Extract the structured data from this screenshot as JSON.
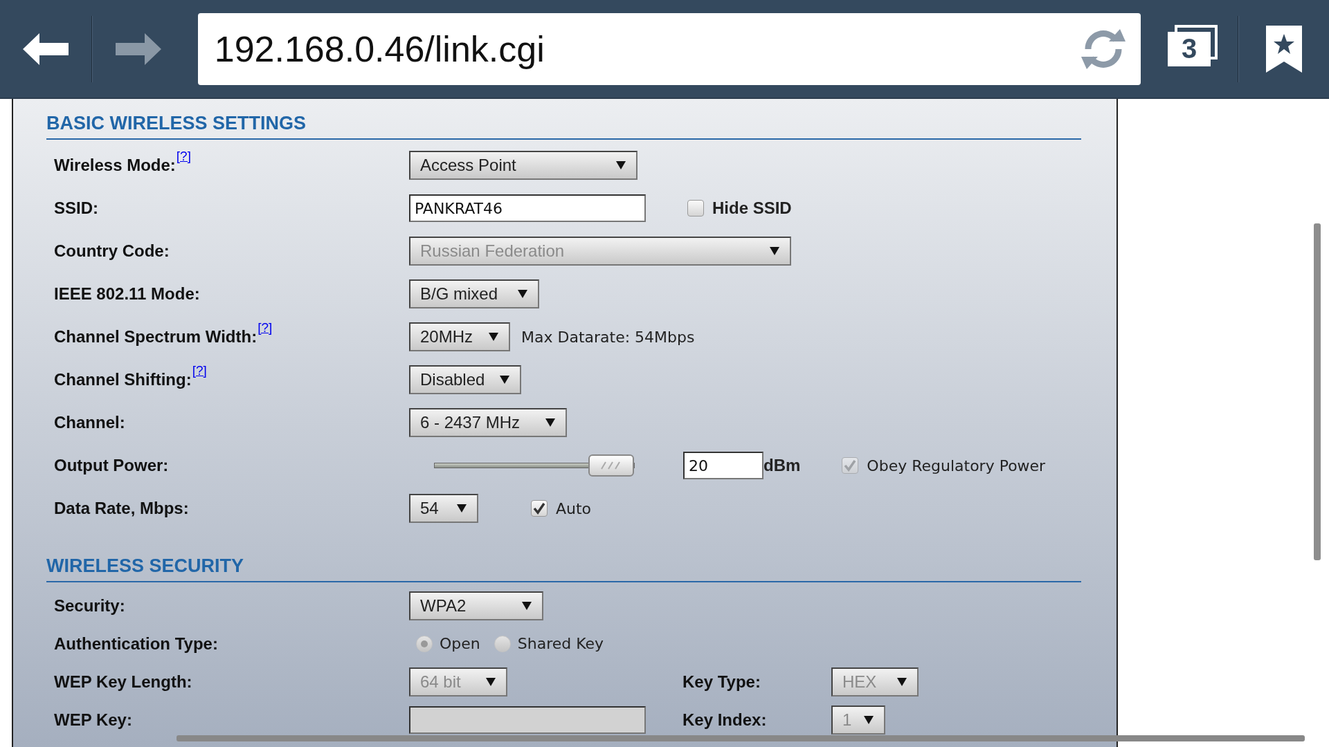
{
  "browser": {
    "url": "192.168.0.46/link.cgi",
    "tab_count": "3",
    "forward_disabled": true
  },
  "sections": [
    {
      "title": "BASIC WIRELESS SETTINGS",
      "rows": [
        {
          "label": "Wireless Mode:",
          "help": "[?]",
          "controls": [
            {
              "kind": "select",
              "value": "Access Point",
              "disabled": false
            }
          ]
        },
        {
          "label": "SSID:",
          "controls": [
            {
              "kind": "text",
              "value": "PANKRAT46",
              "disabled": false
            },
            {
              "kind": "checkbox",
              "label": "Hide SSID",
              "checked": false,
              "disabled": false,
              "bold": true
            }
          ]
        },
        {
          "label": "Country Code:",
          "controls": [
            {
              "kind": "select",
              "value": "Russian Federation",
              "disabled": true
            }
          ]
        },
        {
          "label": "IEEE 802.11 Mode:",
          "controls": [
            {
              "kind": "select",
              "value": "B/G mixed",
              "disabled": false
            }
          ]
        },
        {
          "label": "Channel Spectrum Width:",
          "help": "[?]",
          "controls": [
            {
              "kind": "select",
              "value": "20MHz",
              "disabled": false
            },
            {
              "kind": "note",
              "text": "Max Datarate: 54Mbps"
            }
          ]
        },
        {
          "label": "Channel Shifting:",
          "help": "[?]",
          "controls": [
            {
              "kind": "select",
              "value": "Disabled",
              "disabled": false
            }
          ]
        },
        {
          "label": "Channel:",
          "controls": [
            {
              "kind": "select",
              "value": "6 - 2437 MHz",
              "disabled": false
            }
          ]
        },
        {
          "label": "Output Power:",
          "controls": [
            {
              "kind": "slider",
              "level": 1
            },
            {
              "kind": "text",
              "value": "20",
              "disabled": false
            },
            {
              "kind": "unit",
              "text": "dBm"
            },
            {
              "kind": "checkbox",
              "label": "Obey Regulatory Power",
              "checked": true,
              "disabled": true,
              "bold": false
            }
          ]
        },
        {
          "label": "Data Rate, Mbps:",
          "controls": [
            {
              "kind": "select",
              "value": "54",
              "disabled": false
            },
            {
              "kind": "checkbox",
              "label": "Auto",
              "checked": true,
              "disabled": false,
              "bold": false
            }
          ]
        }
      ]
    },
    {
      "title": "WIRELESS SECURITY",
      "rows": [
        {
          "label": "Security:",
          "controls": [
            {
              "kind": "select",
              "value": "WPA2",
              "disabled": false
            }
          ]
        },
        {
          "label": "Authentication Type:",
          "controls": [
            {
              "kind": "radio",
              "label": "Open",
              "selected": true,
              "disabled": true
            },
            {
              "kind": "radio",
              "label": "Shared Key",
              "selected": false,
              "disabled": true
            }
          ]
        },
        {
          "label": "WEP Key Length:",
          "controls": [
            {
              "kind": "select",
              "value": "64 bit",
              "disabled": true
            }
          ],
          "aside": {
            "label": "Key Type:",
            "control": {
              "kind": "select",
              "value": "HEX",
              "disabled": true
            }
          }
        },
        {
          "label": "WEP Key:",
          "controls": [
            {
              "kind": "text",
              "disabled": true
            }
          ],
          "aside": {
            "label": "Key Index:",
            "control": {
              "kind": "select",
              "value": "1",
              "disabled": true
            }
          }
        }
      ]
    }
  ]
}
